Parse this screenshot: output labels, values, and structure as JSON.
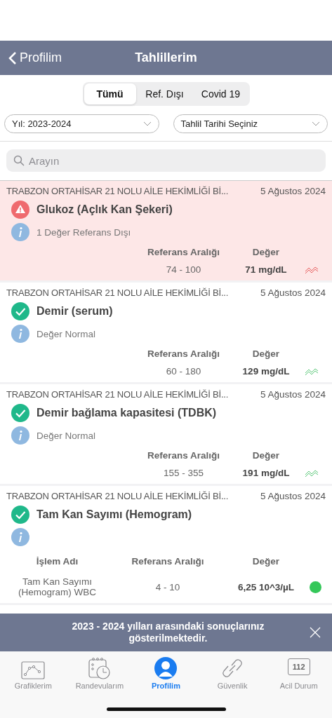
{
  "nav": {
    "back": "Profilim",
    "title": "Tahlillerim"
  },
  "segments": [
    {
      "label": "Tümü",
      "selected": true
    },
    {
      "label": "Ref. Dışı",
      "selected": false
    },
    {
      "label": "Covid 19",
      "selected": false
    }
  ],
  "filters": [
    {
      "value": "Yıl: 2023-2024"
    },
    {
      "value": "Tahlil Tarihi Seçiniz"
    }
  ],
  "search": {
    "placeholder": "Arayın"
  },
  "results": [
    {
      "kind": "single",
      "abnormal": true,
      "facility": "TRABZON ORTAHİSAR 21 NOLU AİLE HEKİMLİĞİ Bİ...",
      "date": "5 Ağustos 2024",
      "name": "Glukoz (Açlık Kan Şekeri)",
      "info": "1 Değer Referans Dışı",
      "columns": [
        "Referans Aralığı",
        "Değer"
      ],
      "range": "74 - 100",
      "value": "71 mg/dL"
    },
    {
      "kind": "single",
      "abnormal": false,
      "facility": "TRABZON ORTAHİSAR 21 NOLU AİLE HEKİMLİĞİ Bİ...",
      "date": "5 Ağustos 2024",
      "name": "Demir (serum)",
      "info": "Değer Normal",
      "columns": [
        "Referans Aralığı",
        "Değer"
      ],
      "range": "60 - 180",
      "value": "129 mg/dL"
    },
    {
      "kind": "single",
      "abnormal": false,
      "facility": "TRABZON ORTAHİSAR 21 NOLU AİLE HEKİMLİĞİ Bİ...",
      "date": "5 Ağustos 2024",
      "name": "Demir bağlama kapasitesi (TDBK)",
      "info": "Değer Normal",
      "columns": [
        "Referans Aralığı",
        "Değer"
      ],
      "range": "155 - 355",
      "value": "191 mg/dL"
    },
    {
      "kind": "panel",
      "abnormal": false,
      "facility": "TRABZON ORTAHİSAR 21 NOLU AİLE HEKİMLİĞİ Bİ...",
      "date": "5 Ağustos 2024",
      "name": "Tam Kan Sayımı (Hemogram)",
      "columns": [
        "İşlem Adı",
        "Referans Aralığı",
        "Değer"
      ],
      "rows": [
        {
          "name": "Tam Kan Sayımı (Hemogram) WBC",
          "range": "4 - 10",
          "value": "6,25 10^3/µL",
          "color": "#34c759"
        }
      ]
    }
  ],
  "banner": {
    "text": "2023 - 2024 yılları arasındaki sonuçlarınız gösterilmektedir."
  },
  "tabbar": [
    {
      "label": "Grafiklerim",
      "selected": false
    },
    {
      "label": "Randevularım",
      "selected": false
    },
    {
      "label": "Profilim",
      "selected": true
    },
    {
      "label": "Güvenlik",
      "selected": false
    },
    {
      "label": "Acil Durum",
      "badge": "112",
      "selected": false
    }
  ]
}
